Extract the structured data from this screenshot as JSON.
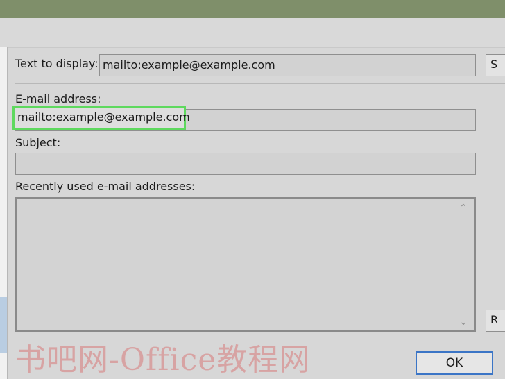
{
  "dialog": {
    "text_to_display": {
      "label": "Text to display:",
      "value": "mailto:example@example.com"
    },
    "email": {
      "label": "E-mail address:",
      "value": "mailto:example@example.com"
    },
    "subject": {
      "label": "Subject:",
      "value": ""
    },
    "recent": {
      "label": "Recently used e-mail addresses:"
    },
    "ok_label": "OK",
    "side_button_1": "S",
    "side_button_2": "R"
  },
  "watermark": "书吧网-Office教程网",
  "colors": {
    "highlight": "#5ed95e",
    "ok_border": "#3b75c6",
    "background_top": "#7f8f6a"
  }
}
